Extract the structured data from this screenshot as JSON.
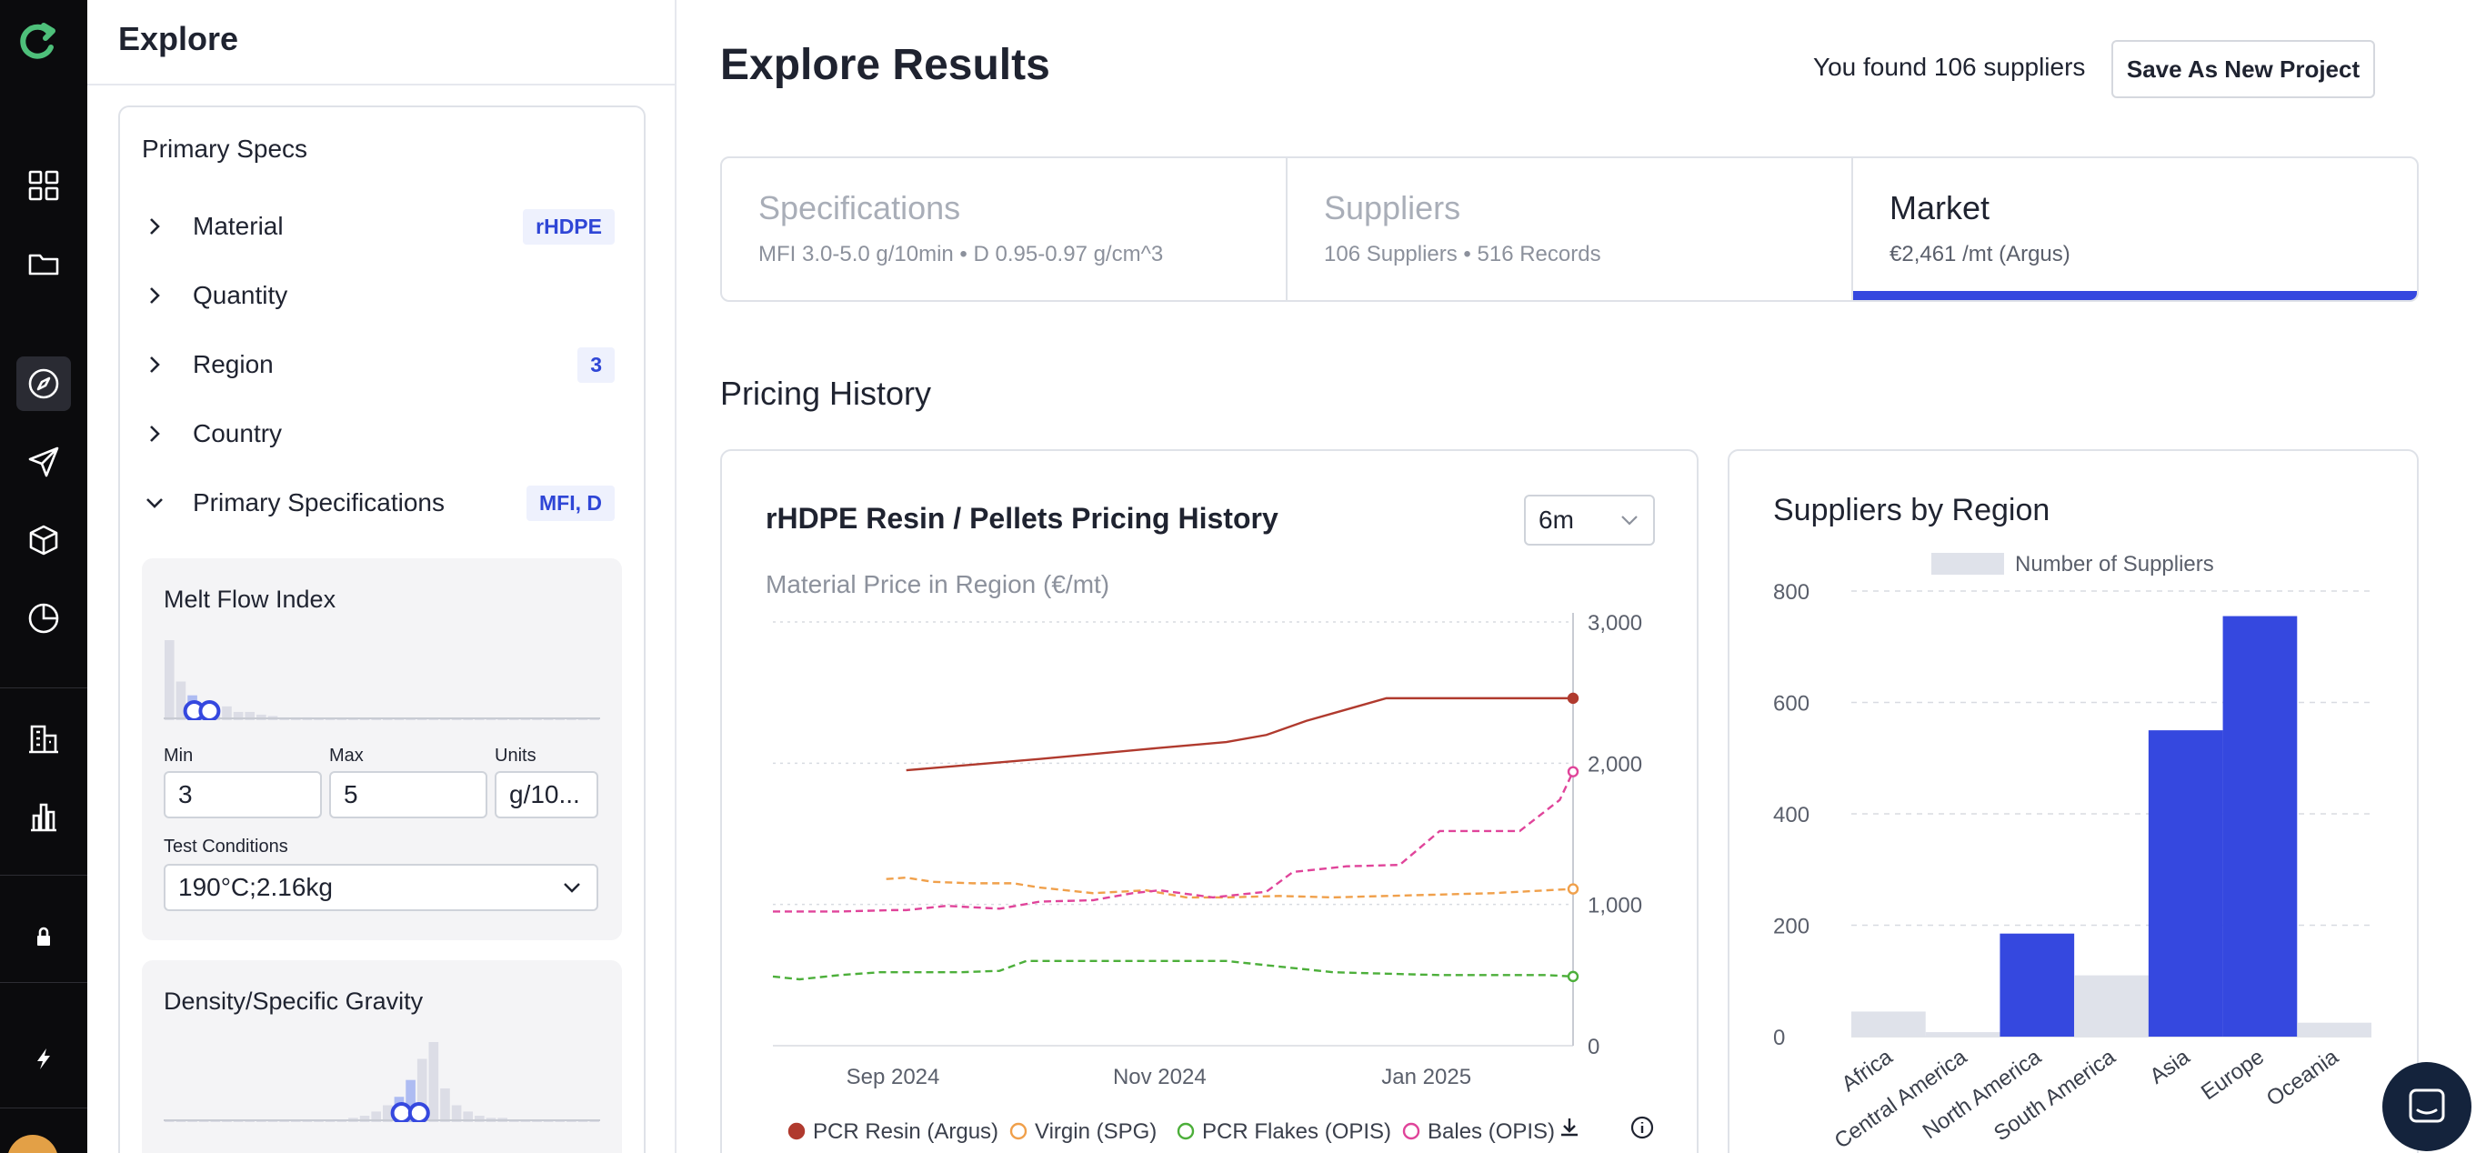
{
  "sidebar": {
    "items": [
      {
        "name": "dashboard",
        "icon": "grid-icon"
      },
      {
        "name": "projects",
        "icon": "folder-icon"
      },
      {
        "name": "explore",
        "icon": "compass-icon",
        "active": true
      },
      {
        "name": "send",
        "icon": "send-icon"
      },
      {
        "name": "products",
        "icon": "cube-icon"
      },
      {
        "name": "reports",
        "icon": "pie-chart-icon"
      },
      {
        "name": "companies",
        "icon": "building-icon"
      },
      {
        "name": "analytics",
        "icon": "bar-chart-icon"
      },
      {
        "name": "lock",
        "icon": "lock-icon"
      },
      {
        "name": "quick",
        "icon": "bolt-icon"
      }
    ]
  },
  "filter_panel": {
    "title": "Explore",
    "card_title": "Primary Specs",
    "filters": [
      {
        "label": "Material",
        "badge": "rHDPE",
        "expanded": false
      },
      {
        "label": "Quantity",
        "badge": "",
        "expanded": false
      },
      {
        "label": "Region",
        "badge": "3",
        "expanded": false
      },
      {
        "label": "Country",
        "badge": "",
        "expanded": false
      },
      {
        "label": "Primary Specifications",
        "badge": "MFI, D",
        "expanded": true
      }
    ],
    "mfi": {
      "title": "Melt Flow Index",
      "histogram": [
        58,
        28,
        18,
        10,
        8,
        10,
        6,
        6,
        4,
        3,
        2,
        2,
        2,
        1,
        1,
        1,
        1,
        1,
        1,
        1,
        1,
        1,
        1,
        1,
        1,
        1,
        1,
        1,
        1,
        1,
        1,
        1,
        1,
        1,
        1,
        1,
        1,
        1
      ],
      "range": [
        3,
        5
      ],
      "min_label": "Min",
      "max_label": "Max",
      "units_label": "Units",
      "min_value": "3",
      "max_value": "5",
      "units_value": "g/10...",
      "test_label": "Test Conditions",
      "test_value": "190°C;2.16kg"
    },
    "density": {
      "title": "Density/Specific Gravity",
      "histogram": [
        1,
        1,
        1,
        1,
        1,
        1,
        1,
        1,
        1,
        1,
        1,
        1,
        1,
        1,
        1,
        1,
        2,
        3,
        5,
        8,
        12,
        20,
        30,
        38,
        16,
        8,
        5,
        3,
        2,
        2,
        1,
        1,
        1,
        1,
        1,
        1,
        1,
        1
      ],
      "range": [
        0.95,
        0.97
      ]
    }
  },
  "header": {
    "title": "Explore Results",
    "found_text": "You found 106 suppliers",
    "save_button": "Save As New Project"
  },
  "tabs": [
    {
      "title": "Specifications",
      "subtitle": "MFI 3.0-5.0 g/10min • D 0.95-0.97 g/cm^3",
      "active": false
    },
    {
      "title": "Suppliers",
      "subtitle": "106 Suppliers • 516 Records",
      "active": false
    },
    {
      "title": "Market",
      "subtitle": "€2,461 /mt (Argus)",
      "active": true
    }
  ],
  "section_title": "Pricing History",
  "colors": {
    "accent": "#3548df",
    "pcr_resin": "#b03a2e",
    "virgin": "#f0a04b",
    "pcr_flakes": "#4caf3a",
    "bales": "#e0449a",
    "bar_highlight": "#3548df",
    "bar_default": "#dfe2ea"
  },
  "chart_data": [
    {
      "type": "line",
      "title": "rHDPE Resin / Pellets Pricing History",
      "subtitle": "Material Price in Region (€/mt)",
      "range_select": "6m",
      "xlabel": "",
      "ylabel": "",
      "ylim": [
        0,
        3000
      ],
      "yticks": [
        "0",
        "1,000",
        "2,000",
        "3,000"
      ],
      "x_tick_labels": [
        "Sep 2024",
        "Nov 2024",
        "Jan 2025"
      ],
      "x_tick_positions": [
        0.9,
        2.9,
        4.9
      ],
      "xlim": [
        0,
        6
      ],
      "grid": true,
      "legend_position": "bottom",
      "series": [
        {
          "name": "PCR Resin (Argus)",
          "style": "solid",
          "marker": "filled",
          "x": [
            1.0,
            2.0,
            2.8,
            3.4,
            3.7,
            4.0,
            4.3,
            4.6,
            5.0,
            5.4,
            6.0
          ],
          "y": [
            1950,
            2030,
            2100,
            2150,
            2200,
            2300,
            2380,
            2460,
            2460,
            2460,
            2460
          ]
        },
        {
          "name": "Virgin (SPG)",
          "style": "dashed",
          "marker": "hollow",
          "x": [
            0.85,
            1.0,
            1.2,
            1.5,
            1.8,
            2.0,
            2.4,
            2.8,
            3.1,
            3.4,
            3.8,
            4.2,
            4.6,
            5.0,
            5.4,
            5.8,
            6.0
          ],
          "y": [
            1180,
            1190,
            1160,
            1150,
            1150,
            1120,
            1080,
            1100,
            1050,
            1050,
            1060,
            1050,
            1060,
            1070,
            1080,
            1100,
            1110
          ]
        },
        {
          "name": "PCR Flakes (OPIS)",
          "style": "dashed",
          "marker": "hollow",
          "x": [
            0,
            0.2,
            0.5,
            0.8,
            1.0,
            1.4,
            1.7,
            1.9,
            2.2,
            2.6,
            3.0,
            3.4,
            3.8,
            4.2,
            4.6,
            5.0,
            5.4,
            5.8,
            6.0
          ],
          "y": [
            490,
            470,
            500,
            520,
            520,
            520,
            530,
            600,
            600,
            600,
            600,
            600,
            560,
            520,
            510,
            500,
            500,
            500,
            490
          ]
        },
        {
          "name": "Bales (OPIS)",
          "style": "dashed",
          "marker": "hollow",
          "x": [
            0,
            0.5,
            0.9,
            1.0,
            1.3,
            1.7,
            2.0,
            2.4,
            2.7,
            2.9,
            3.3,
            3.7,
            3.9,
            4.3,
            4.7,
            5.0,
            5.3,
            5.6,
            5.9,
            6.0
          ],
          "y": [
            950,
            950,
            960,
            960,
            990,
            970,
            1020,
            1030,
            1080,
            1100,
            1050,
            1090,
            1230,
            1270,
            1280,
            1520,
            1520,
            1520,
            1740,
            1940
          ]
        }
      ]
    },
    {
      "type": "bar",
      "title": "Suppliers by Region",
      "legend": "Number of Suppliers",
      "ylim": [
        0,
        800
      ],
      "yticks": [
        "0",
        "200",
        "400",
        "600",
        "800"
      ],
      "grid": true,
      "categories": [
        "Africa",
        "Central America",
        "North America",
        "South America",
        "Asia",
        "Europe",
        "Oceania"
      ],
      "values": [
        45,
        8,
        185,
        110,
        550,
        755,
        25
      ],
      "highlighted": [
        false,
        false,
        true,
        false,
        true,
        true,
        false
      ]
    }
  ]
}
